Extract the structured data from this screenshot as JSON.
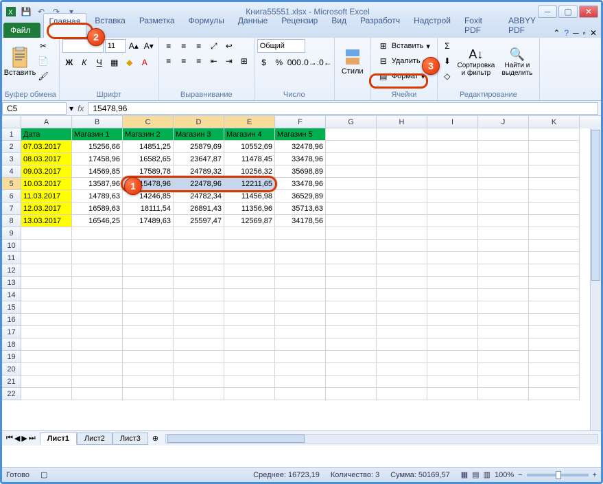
{
  "title": "Книга55551.xlsx - Microsoft Excel",
  "tabs": {
    "file": "Файл",
    "items": [
      "Главная",
      "Вставка",
      "Разметка",
      "Формулы",
      "Данные",
      "Рецензир",
      "Вид",
      "Разработч",
      "Надстрой",
      "Foxit PDF",
      "ABBYY PDF"
    ],
    "active_index": 0
  },
  "ribbon": {
    "clipboard": {
      "label": "Буфер обмена",
      "paste": "Вставить"
    },
    "font": {
      "label": "Шрифт",
      "size": "11"
    },
    "alignment": {
      "label": "Выравнивание"
    },
    "number": {
      "label": "Число",
      "format": "Общий"
    },
    "styles": {
      "label": "",
      "btn": "Стили"
    },
    "cells": {
      "label": "Ячейки",
      "insert": "Вставить",
      "delete": "Удалить",
      "format": "Формат"
    },
    "editing": {
      "label": "Редактирование",
      "sort": "Сортировка и фильтр",
      "find": "Найти и выделить"
    }
  },
  "formula_bar": {
    "name_box": "C5",
    "value": "15478,96"
  },
  "columns": [
    "A",
    "B",
    "C",
    "D",
    "E",
    "F",
    "G",
    "H",
    "I",
    "J",
    "K"
  ],
  "row_numbers": [
    "1",
    "2",
    "3",
    "4",
    "5",
    "6",
    "7",
    "8",
    "9",
    "10",
    "11",
    "12",
    "13",
    "14",
    "15",
    "16",
    "17",
    "18",
    "19",
    "20",
    "21",
    "22"
  ],
  "chart_data": {
    "type": "table",
    "headers": [
      "Дата",
      "Магазин 1",
      "Магазин 2",
      "Магазин 3",
      "Магазин 4",
      "Магазин 5"
    ],
    "rows": [
      [
        "07.03.2017",
        "15256,66",
        "14851,25",
        "25879,69",
        "10552,69",
        "32478,96"
      ],
      [
        "08.03.2017",
        "17458,96",
        "16582,65",
        "23647,87",
        "11478,45",
        "33478,96"
      ],
      [
        "09.03.2017",
        "14569,85",
        "17589,78",
        "24789,32",
        "10256,32",
        "35698,89"
      ],
      [
        "10.03.2017",
        "13587,96",
        "15478,96",
        "22478,96",
        "12211,65",
        "33478,96"
      ],
      [
        "11.03.2017",
        "14789,63",
        "14246,85",
        "24782,34",
        "11456,98",
        "36529,89"
      ],
      [
        "12.03.2017",
        "16589,63",
        "18111,54",
        "26891,43",
        "11356,96",
        "35713,63"
      ],
      [
        "13.03.2017",
        "16546,25",
        "17489,63",
        "25597,47",
        "12569,87",
        "34178,56"
      ]
    ]
  },
  "selected_range": "C5:E5",
  "sheets": {
    "items": [
      "Лист1",
      "Лист2",
      "Лист3"
    ],
    "active_index": 0
  },
  "statusbar": {
    "ready": "Готово",
    "average_label": "Среднее:",
    "average_value": "16723,19",
    "count_label": "Количество:",
    "count_value": "3",
    "sum_label": "Сумма:",
    "sum_value": "50169,57",
    "zoom": "100%"
  },
  "callouts": {
    "c1": "1",
    "c2": "2",
    "c3": "3"
  }
}
